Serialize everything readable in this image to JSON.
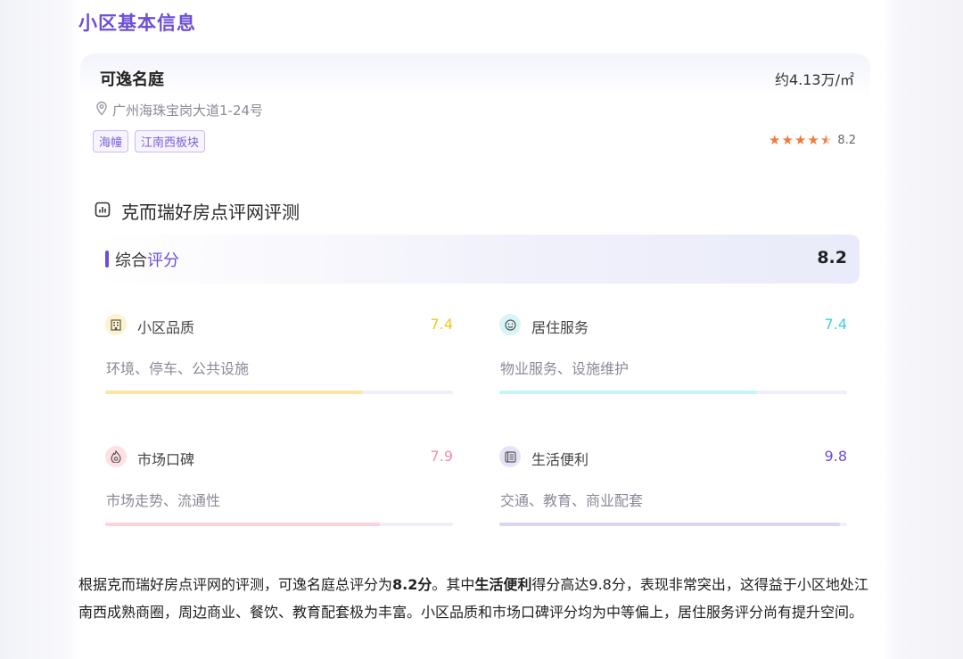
{
  "section_title": "小区基本信息",
  "community": {
    "name": "可逸名庭",
    "price": "约4.13万/㎡",
    "address": "广州海珠宝岗大道1-24号",
    "tags": [
      "海幢",
      "江南西板块"
    ],
    "rating": {
      "score_text": "8.2",
      "stars": 4.5
    }
  },
  "evaluation": {
    "title": "克而瑞好房点评网评测",
    "overall": {
      "label_prefix": "综合",
      "label_suffix": "评分",
      "score": "8.2"
    },
    "categories": [
      {
        "name": "小区品质",
        "score": "7.4",
        "desc": "环境、停车、公共设施",
        "icon": "building-icon",
        "color": "#f5c518",
        "icon_bg": "#fdf3d0",
        "fill_color": "#fbe6a6",
        "level": 0.74
      },
      {
        "name": "居住服务",
        "score": "7.4",
        "desc": "物业服务、设施维护",
        "icon": "smile-icon",
        "color": "#3fd0dc",
        "icon_bg": "#d8f5f6",
        "fill_color": "#c4f4f6",
        "level": 0.74
      },
      {
        "name": "市场口碑",
        "score": "7.9",
        "desc": "市场走势、流通性",
        "icon": "fire-icon",
        "color": "#f08fa8",
        "icon_bg": "#fde1e6",
        "fill_color": "#fcd3da",
        "level": 0.79
      },
      {
        "name": "生活便利",
        "score": "9.8",
        "desc": "交通、教育、商业配套",
        "icon": "list-icon",
        "color": "#6c4ed8",
        "icon_bg": "#e6e3f7",
        "fill_color": "#d9d6f3",
        "level": 0.98
      }
    ]
  },
  "summary": {
    "p1": "根据克而瑞好房点评网的评测，可逸名庭总评分为",
    "b1": "8.2分",
    "p2": "。其中",
    "b2": "生活便利",
    "p3": "得分高达9.8分，表现非常突出，这得益于小区地处江南西成熟商圈，周边商业、餐饮、教育配套极为丰富。小区品质和市场口碑评分均为中等偏上，居住服务评分尚有提升空间。"
  }
}
